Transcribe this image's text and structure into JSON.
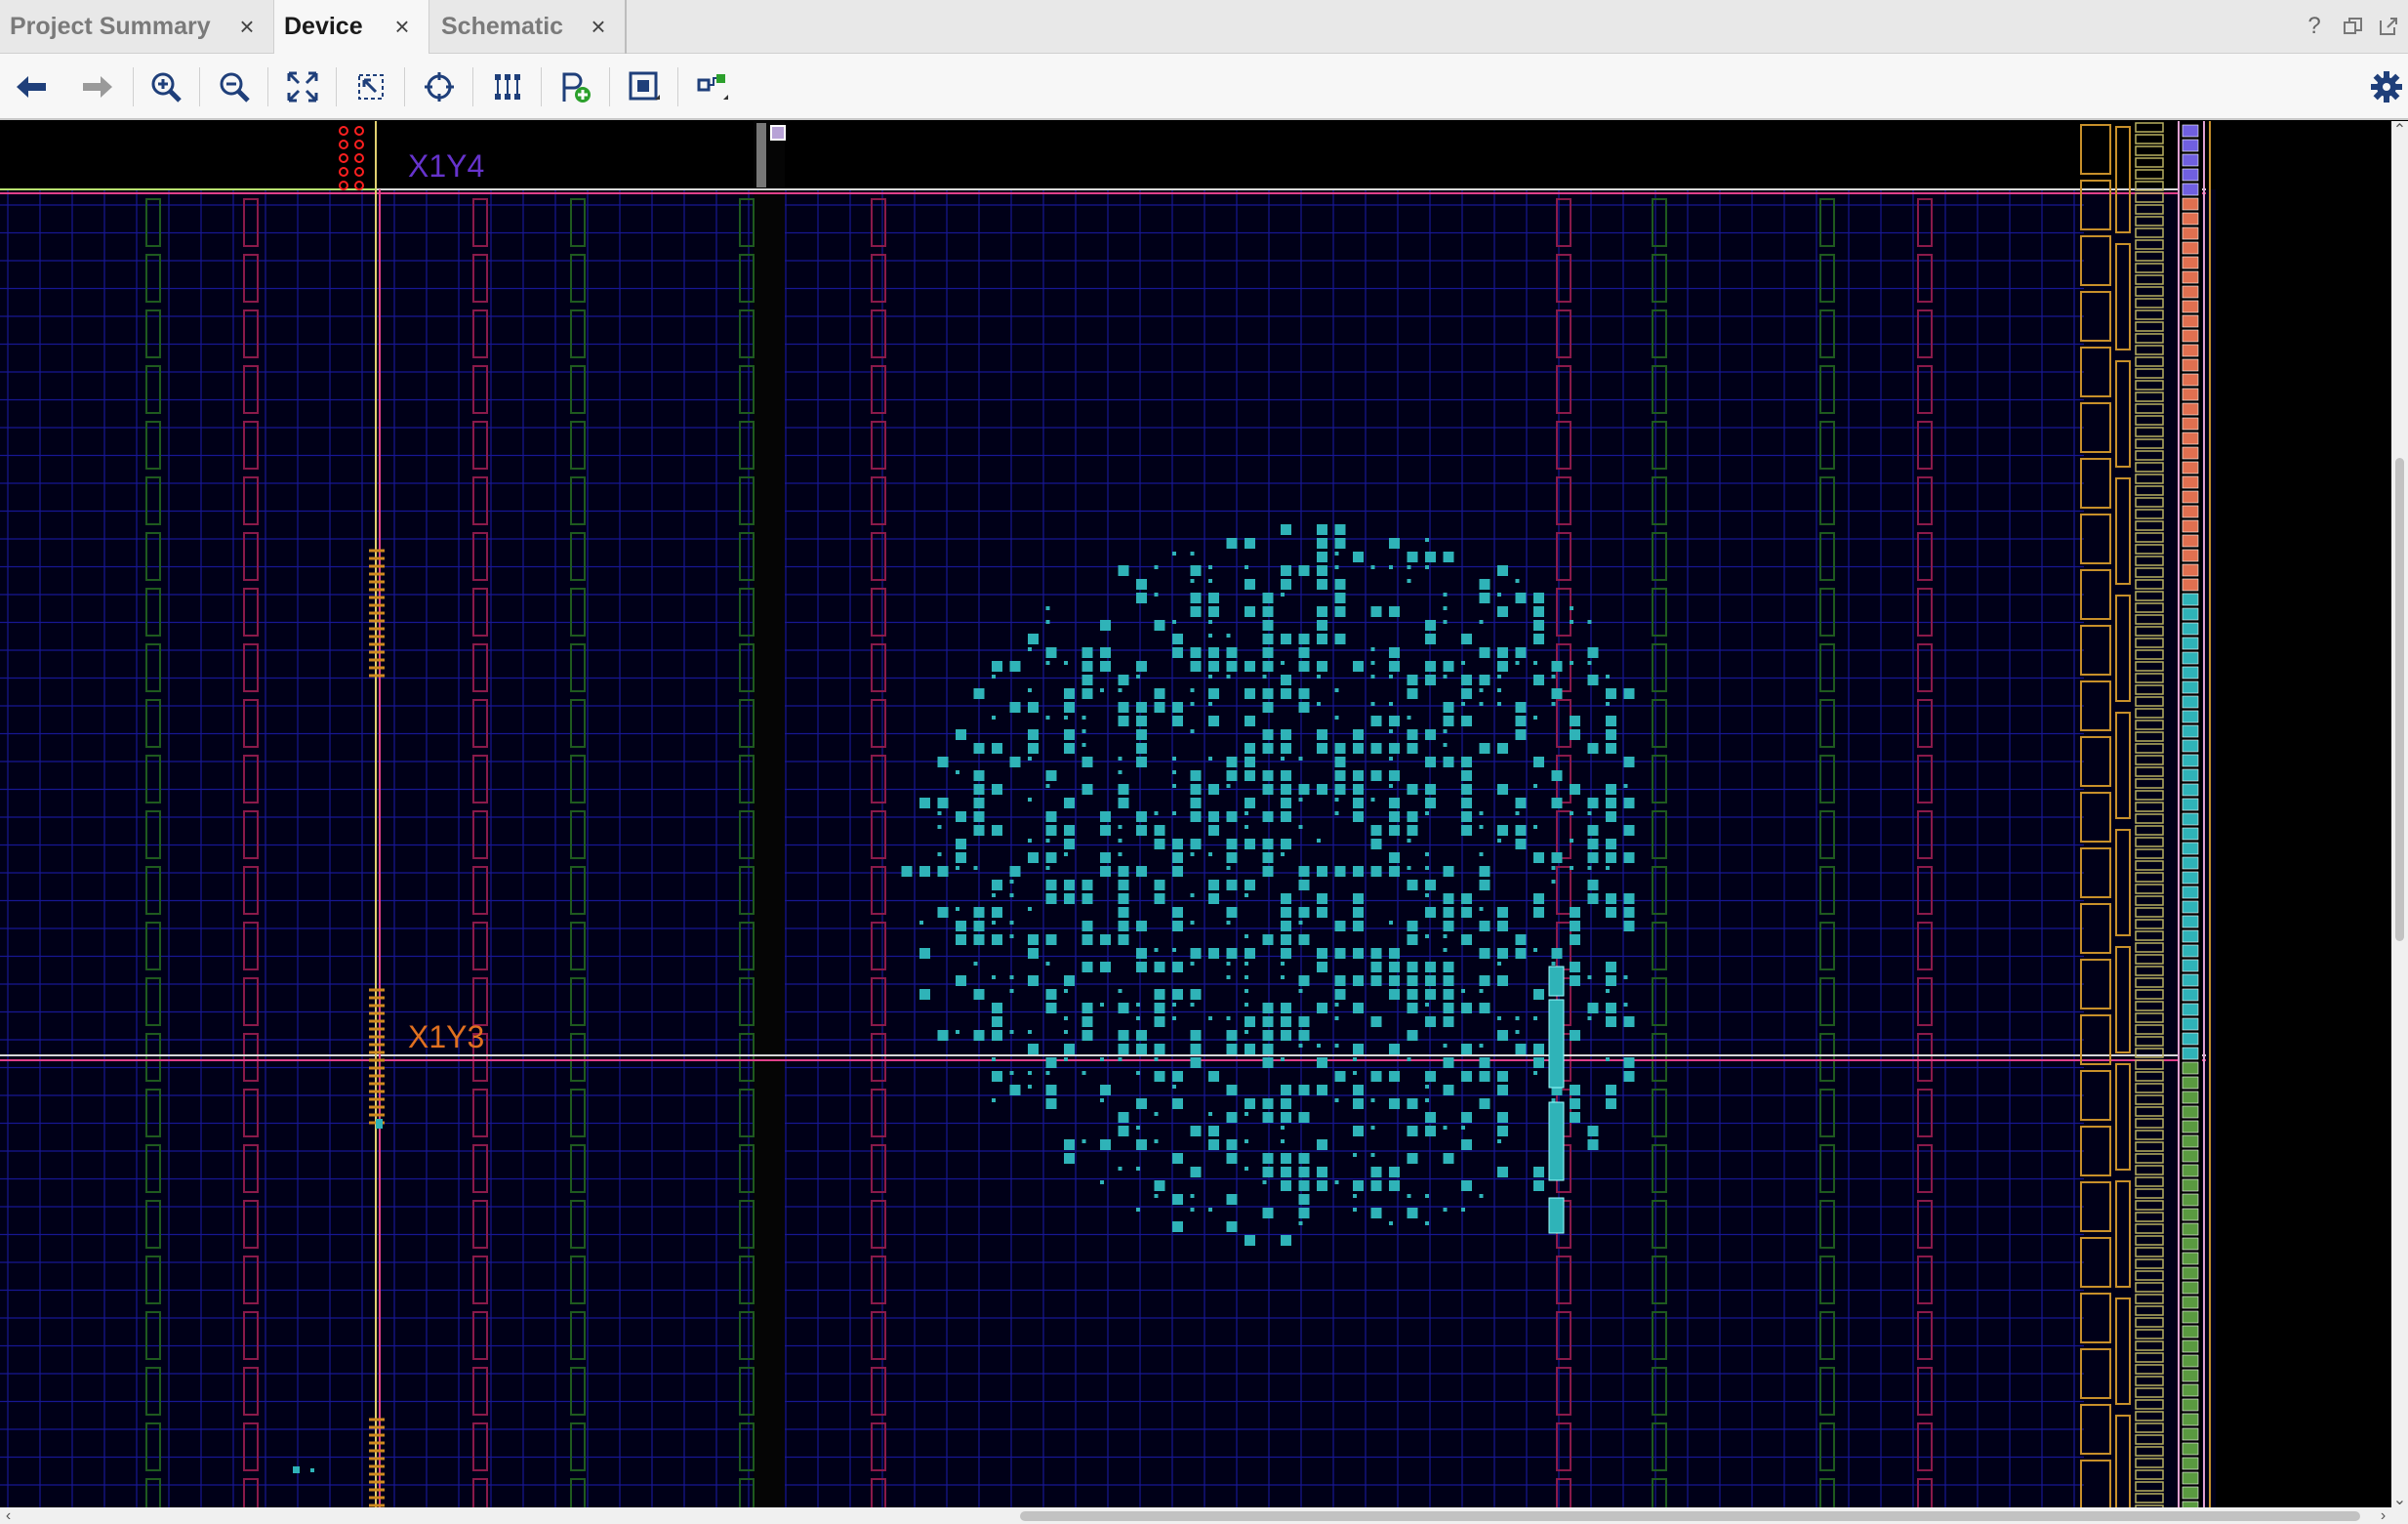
{
  "tabs": [
    {
      "label": "Project Summary",
      "state": "inactive"
    },
    {
      "label": "Device",
      "state": "active"
    },
    {
      "label": "Schematic",
      "state": "inactive"
    }
  ],
  "tab_close_glyph": "×",
  "window_controls": {
    "help": "?",
    "restore": "restore-icon",
    "float": "float-icon"
  },
  "toolbar": {
    "buttons": [
      "back-icon",
      "forward-icon",
      "zoom-in-icon",
      "zoom-out-icon",
      "zoom-fit-icon",
      "zoom-selection-icon",
      "auto-fit-selection-icon",
      "routing-resources-icon",
      "add-pblock-icon",
      "show-io-banks-icon",
      "select-nets-icon"
    ],
    "settings": "gear-icon"
  },
  "device": {
    "regions": [
      {
        "label": "X1Y4",
        "color": "#6633cc"
      },
      {
        "label": "X1Y3",
        "color": "#e07020"
      }
    ],
    "colors": {
      "background": "#000000",
      "grid": "#1a1aa0",
      "placed_cell": "#2fb3b8",
      "clock_region_border": "#d8d8d8",
      "pblock_border": "#e0408a",
      "dsp_column": "#8a1a4a",
      "bram_column": "#1f5a1f",
      "io_column": "#c8902a"
    }
  }
}
